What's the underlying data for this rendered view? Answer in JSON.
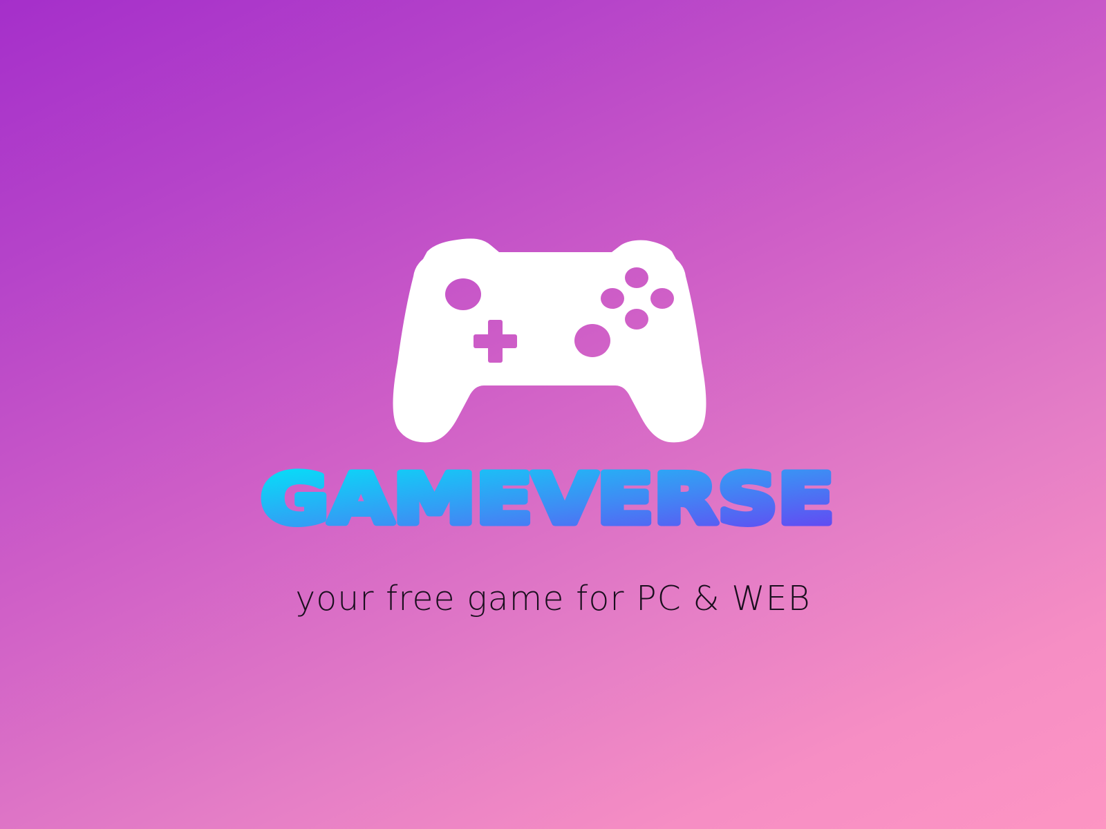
{
  "brand": {
    "name": "GAMEVERSE",
    "tagline": "your free game for PC & WEB",
    "gradient_start": "#00e8f8",
    "gradient_end": "#6a3cf2",
    "icon": "gamepad-icon"
  },
  "colors": {
    "background_top_left": "#a52fca",
    "background_bottom_right": "#fd95c3",
    "icon_fill": "#ffffff",
    "tagline": "#1a0f1e"
  }
}
